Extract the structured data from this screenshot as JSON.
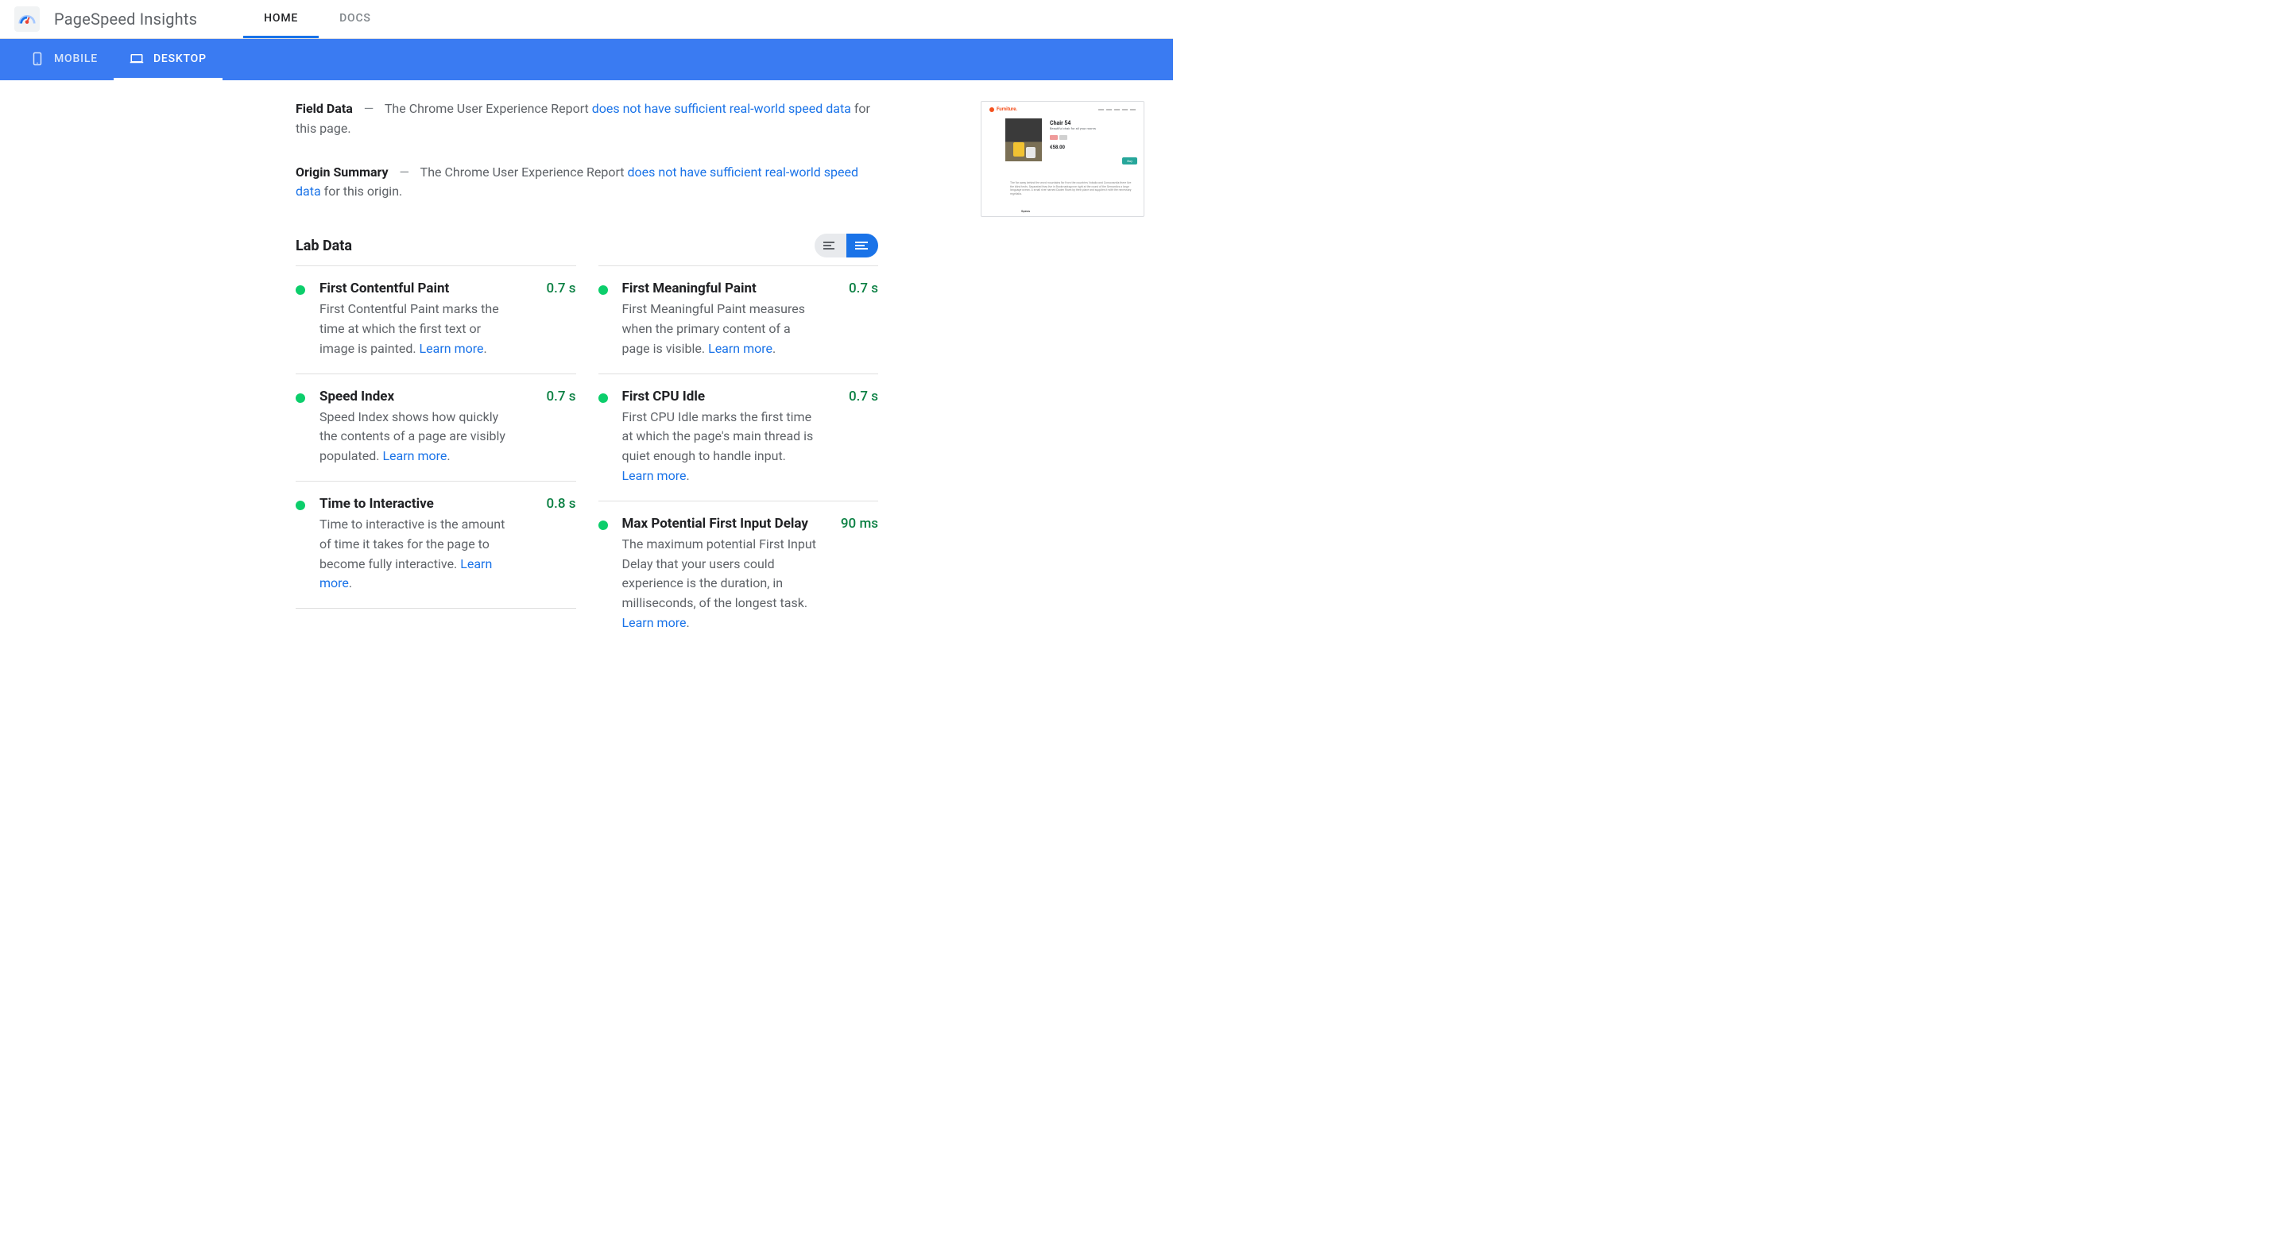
{
  "brand": "PageSpeed Insights",
  "top_tabs": {
    "home": "HOME",
    "docs": "DOCS"
  },
  "device_tabs": {
    "mobile": "MOBILE",
    "desktop": "DESKTOP"
  },
  "field_data": {
    "title": "Field Data",
    "pre": "The Chrome User Experience Report ",
    "link": "does not have sufficient real-world speed data",
    "post": " for this page."
  },
  "origin_summary": {
    "title": "Origin Summary",
    "pre": "The Chrome User Experience Report ",
    "link": "does not have sufficient real-world speed data",
    "post": " for this origin."
  },
  "lab_data_title": "Lab Data",
  "learn_more": "Learn more",
  "metrics_left": [
    {
      "title": "First Contentful Paint",
      "value": "0.7 s",
      "desc": "First Contentful Paint marks the time at which the first text or image is painted."
    },
    {
      "title": "Speed Index",
      "value": "0.7 s",
      "desc": "Speed Index shows how quickly the contents of a page are visibly populated."
    },
    {
      "title": "Time to Interactive",
      "value": "0.8 s",
      "desc": "Time to interactive is the amount of time it takes for the page to become fully interactive."
    }
  ],
  "metrics_right": [
    {
      "title": "First Meaningful Paint",
      "value": "0.7 s",
      "desc": "First Meaningful Paint measures when the primary content of a page is visible."
    },
    {
      "title": "First CPU Idle",
      "value": "0.7 s",
      "desc": "First CPU Idle marks the first time at which the page's main thread is quiet enough to handle input."
    },
    {
      "title": "Max Potential First Input Delay",
      "value": "90 ms",
      "desc": "The maximum potential First Input Delay that your users could experience is the duration, in milliseconds, of the longest task."
    }
  ],
  "preview": {
    "brand": "Furniture.",
    "product_title": "Chair 54",
    "product_sub": "Beautiful chair for all your rooms",
    "price": "€58.00",
    "btn": "Buy",
    "footer": "Specs"
  }
}
